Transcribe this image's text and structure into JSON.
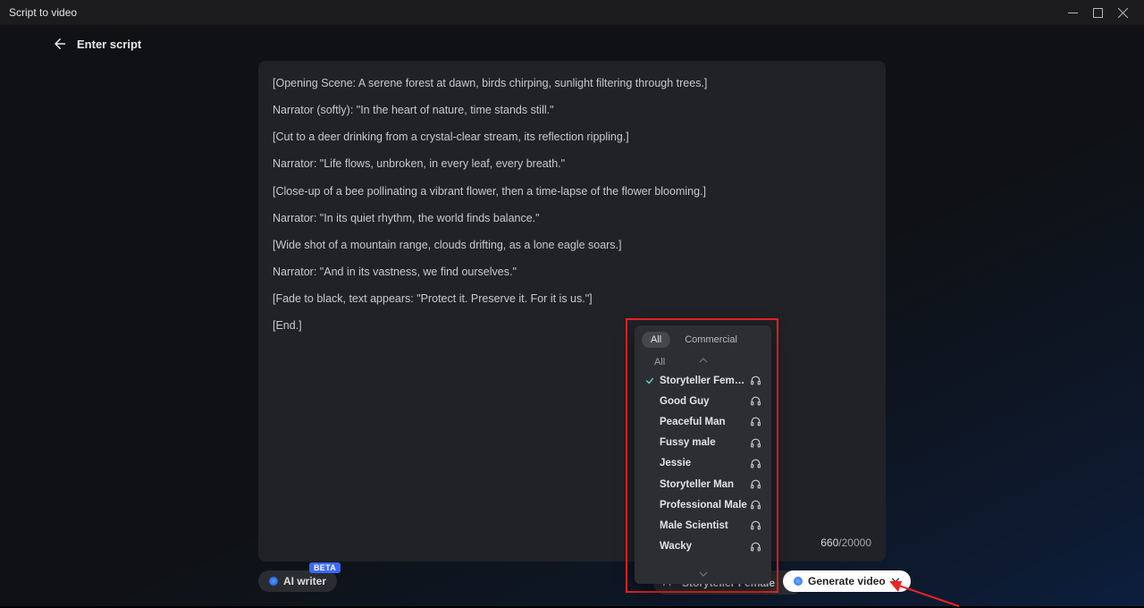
{
  "window": {
    "title": "Script to video"
  },
  "header": {
    "back_label": "Enter script"
  },
  "script": {
    "lines": [
      "[Opening Scene: A serene forest at dawn, birds chirping, sunlight filtering through trees.]",
      "Narrator (softly): \"In the heart of nature, time stands still.\"",
      "[Cut to a deer drinking from a crystal-clear stream, its reflection rippling.]",
      "Narrator: \"Life flows, unbroken, in every leaf, every breath.\"",
      "[Close-up of a bee pollinating a vibrant flower, then a time-lapse of the flower blooming.]",
      "Narrator: \"In its quiet rhythm, the world finds balance.\"",
      "[Wide shot of a mountain range, clouds drifting, as a lone eagle soars.]",
      "Narrator: \"And in its vastness, we find ourselves.\"",
      "[Fade to black, text appears: \"Protect it. Preserve it. For it is us.\"]",
      "[End.]"
    ],
    "count_current": "660",
    "count_sep": "/",
    "count_max": "20000"
  },
  "toolbar": {
    "ai_writer_label": "AI writer",
    "ai_writer_badge": "BETA",
    "voice_selected": "Storyteller Female",
    "generate_label": "Generate video"
  },
  "voice_popup": {
    "tabs": [
      {
        "label": "All",
        "active": true
      },
      {
        "label": "Commercial",
        "active": false
      }
    ],
    "group_label": "All",
    "items": [
      {
        "label": "Storyteller Female",
        "selected": true
      },
      {
        "label": "Good Guy",
        "selected": false
      },
      {
        "label": "Peaceful Man",
        "selected": false
      },
      {
        "label": "Fussy male",
        "selected": false
      },
      {
        "label": "Jessie",
        "selected": false
      },
      {
        "label": "Storyteller Man",
        "selected": false
      },
      {
        "label": "Professional Male",
        "selected": false
      },
      {
        "label": "Male Scientist",
        "selected": false
      },
      {
        "label": "Wacky",
        "selected": false
      }
    ]
  }
}
